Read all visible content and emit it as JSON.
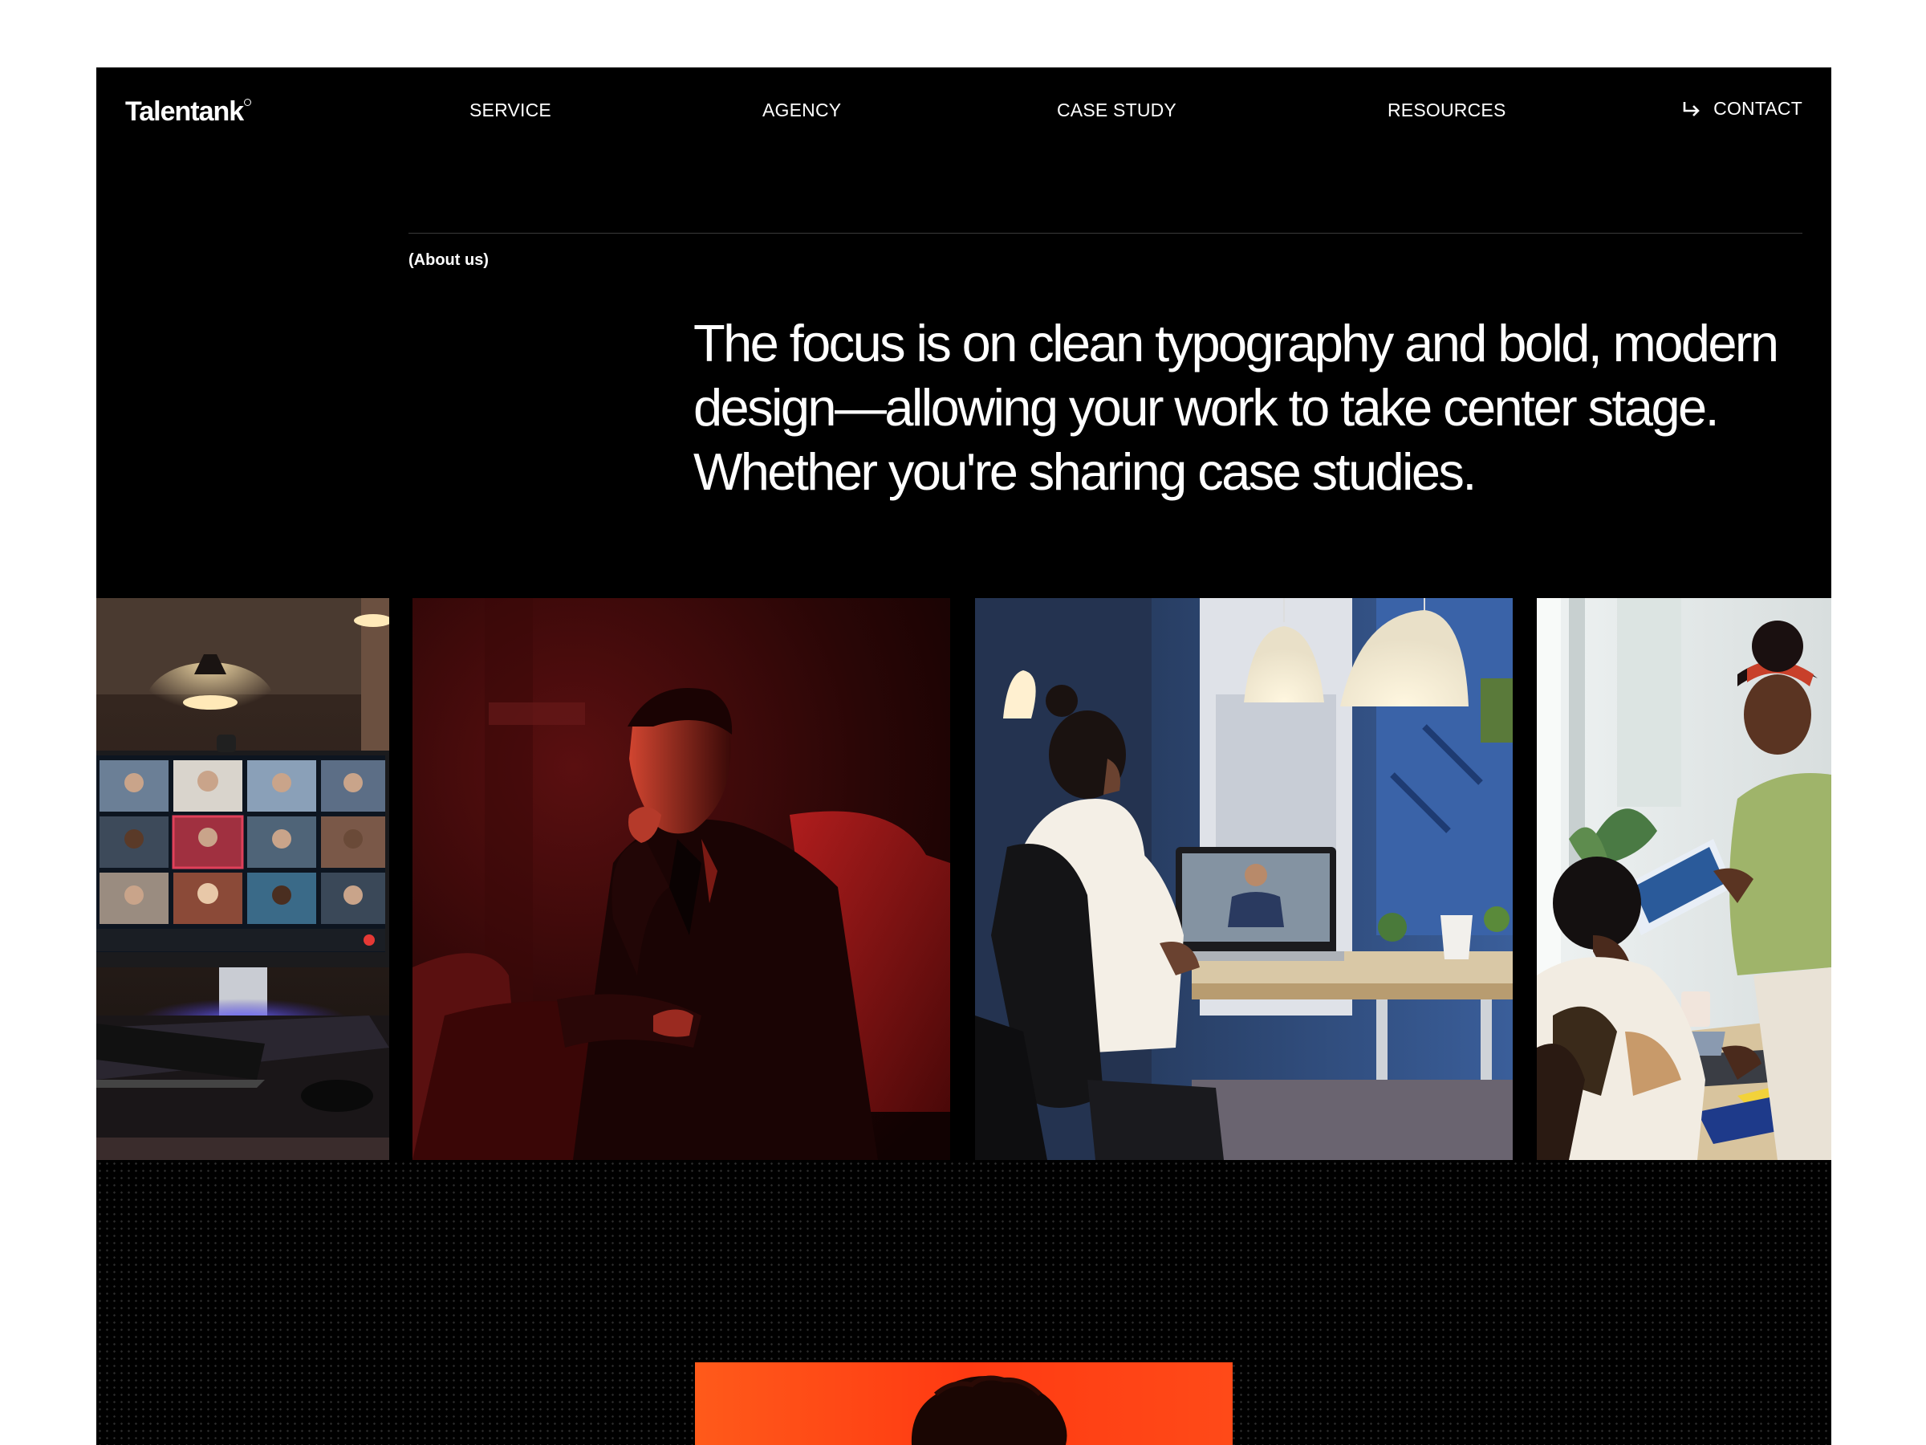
{
  "nav": {
    "logo": "Talentank",
    "links": [
      "SERVICE",
      "AGENCY",
      "CASE STUDY",
      "RESOURCES"
    ],
    "contact": "CONTACT",
    "contact_icon": "arrow-down-right-icon"
  },
  "about": {
    "label": "(About us)",
    "headline": "The focus is on clean typography and bold, modern design—allowing your work to take center stage. Whether you're sharing case studies."
  },
  "gallery": {
    "images": [
      "video-conference-monitor-photo",
      "man-in-red-light-photo",
      "woman-on-video-call-office-photo",
      "team-reviewing-documents-photo"
    ]
  },
  "colors": {
    "background": "#000000",
    "page": "#ffffff",
    "text": "#ffffff",
    "accent": "#ff3a14"
  }
}
